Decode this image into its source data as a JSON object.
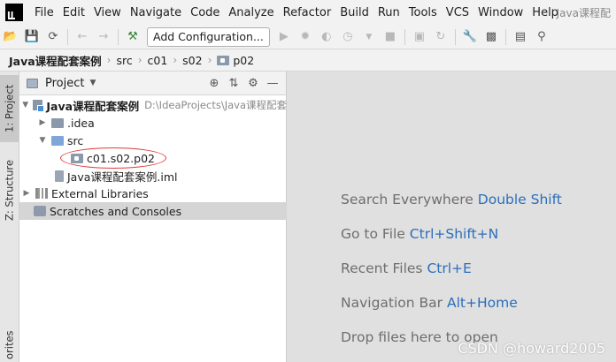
{
  "app": {
    "title": "Java课程配"
  },
  "menu": [
    "File",
    "Edit",
    "View",
    "Navigate",
    "Code",
    "Analyze",
    "Refactor",
    "Build",
    "Run",
    "Tools",
    "VCS",
    "Window",
    "Help"
  ],
  "toolbar": {
    "config_label": "Add Configuration..."
  },
  "breadcrumbs": [
    "Java课程配套案例",
    "src",
    "c01",
    "s02",
    "p02"
  ],
  "left_tabs": {
    "project": "1: Project",
    "structure": "Z: Structure",
    "favorites": "orites"
  },
  "panel": {
    "title": "Project"
  },
  "tree": {
    "root": {
      "name": "Java课程配套案例",
      "path": "D:\\IdeaProjects\\Java课程配套"
    },
    "idea": ".idea",
    "src": "src",
    "package": "c01.s02.p02",
    "iml": "Java课程配套案例.iml",
    "external": "External Libraries",
    "scratches": "Scratches and Consoles"
  },
  "hints": [
    {
      "text": "Search Everywhere",
      "key": "Double Shift"
    },
    {
      "text": "Go to File",
      "key": "Ctrl+Shift+N"
    },
    {
      "text": "Recent Files",
      "key": "Ctrl+E"
    },
    {
      "text": "Navigation Bar",
      "key": "Alt+Home"
    },
    {
      "text": "Drop files here to open",
      "key": ""
    }
  ],
  "watermark": "CSDN @howard2005",
  "colors": {
    "accent_key": "#2a6ebb",
    "annotation": "#e03a3a"
  }
}
